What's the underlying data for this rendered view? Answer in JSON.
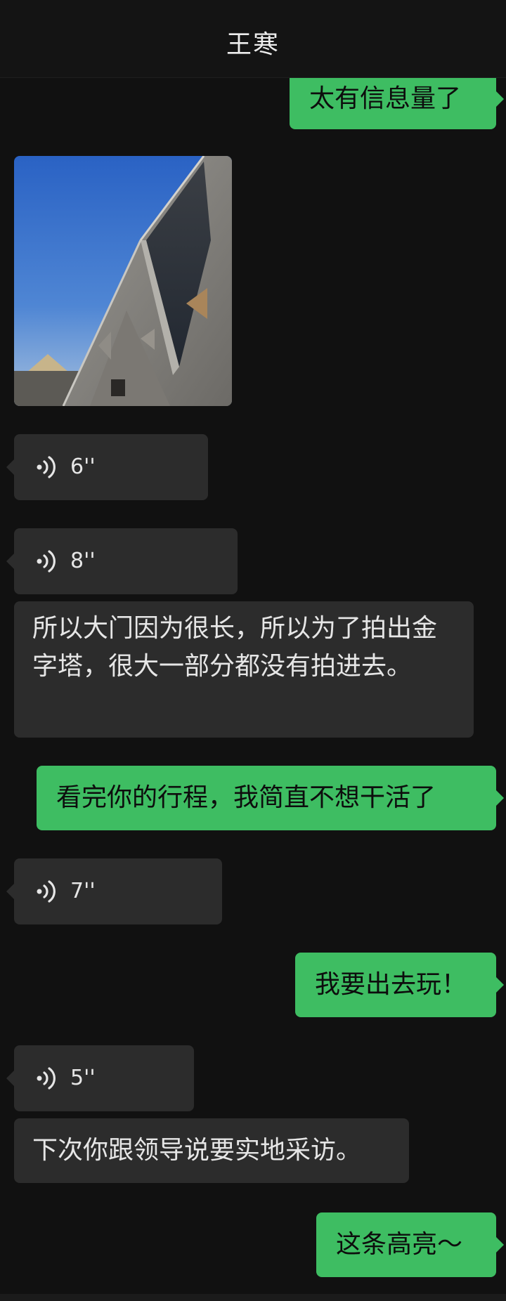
{
  "header": {
    "title": "王寒"
  },
  "messages": [
    {
      "type": "text",
      "side": "sent",
      "text": "太有信息量了"
    },
    {
      "type": "image",
      "side": "recv",
      "alt": "pyramid-photo"
    },
    {
      "type": "voice",
      "side": "recv",
      "duration": "6''"
    },
    {
      "type": "voice",
      "side": "recv",
      "duration": "8''"
    },
    {
      "type": "text",
      "side": "recv",
      "text": "所以大门因为很长，所以为了拍出金字塔，很大一部分都没有拍进去。"
    },
    {
      "type": "text",
      "side": "sent",
      "text": "看完你的行程，我简直不想干活了"
    },
    {
      "type": "voice",
      "side": "recv",
      "duration": "7''"
    },
    {
      "type": "text",
      "side": "sent",
      "text": "我要出去玩！"
    },
    {
      "type": "voice",
      "side": "recv",
      "duration": "5''"
    },
    {
      "type": "text",
      "side": "recv",
      "text": "下次你跟领导说要实地采访。"
    },
    {
      "type": "text",
      "side": "sent",
      "text": "这条高亮～"
    }
  ],
  "colors": {
    "background": "#111111",
    "sent_bubble": "#3ebd62",
    "recv_bubble": "#2c2c2c",
    "sky_top": "#2e67c8",
    "sky_bottom": "#8fb2d8",
    "stone": "#8a8a86"
  },
  "icons": {
    "voice": "voice-wave-icon"
  }
}
